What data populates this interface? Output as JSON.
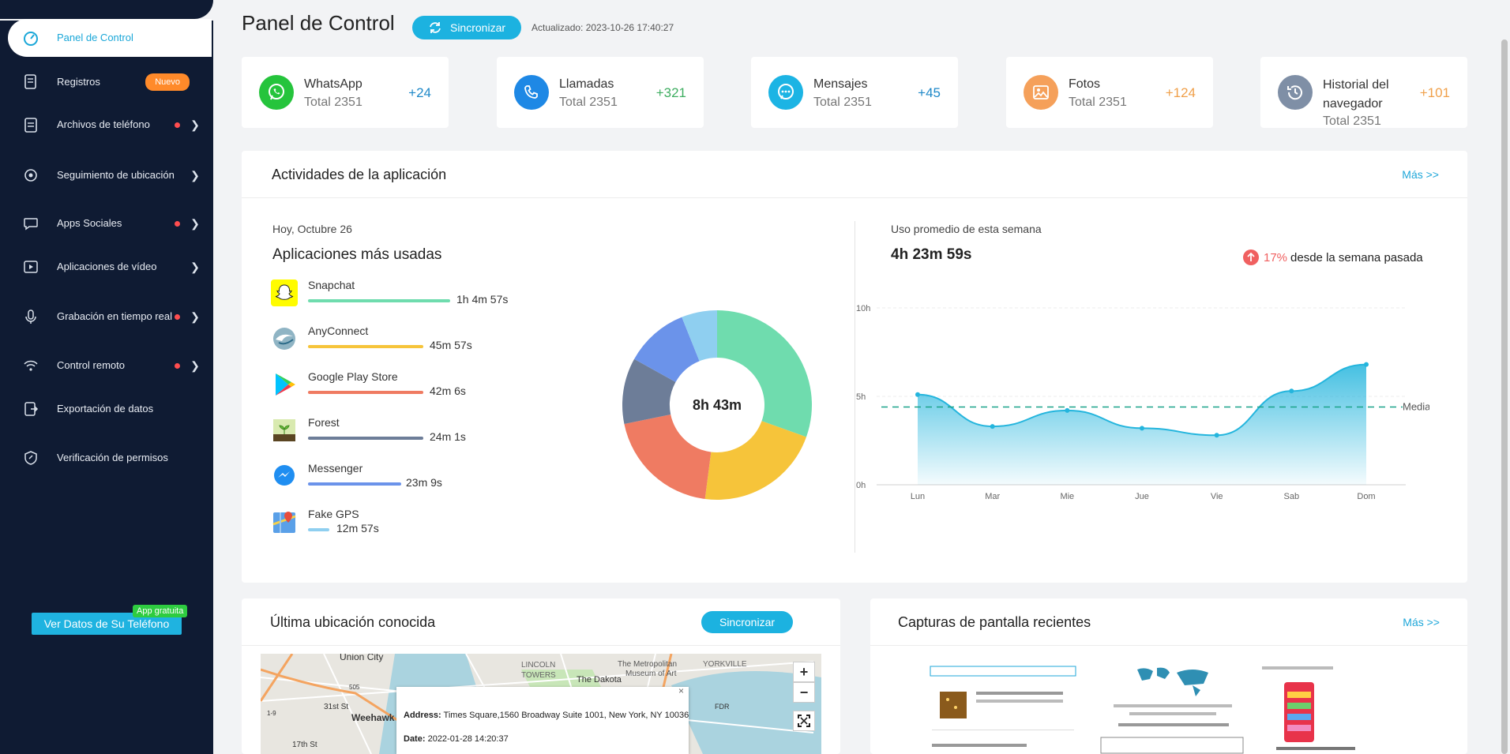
{
  "sidebar": {
    "items": [
      {
        "label": "Panel de Control"
      },
      {
        "label": "Registros",
        "badge": "Nuevo"
      },
      {
        "label": "Archivos de teléfono"
      },
      {
        "label": "Seguimiento de ubicación"
      },
      {
        "label": "Apps Sociales"
      },
      {
        "label": "Aplicaciones de vídeo"
      },
      {
        "label": "Grabación en tiempo real"
      },
      {
        "label": "Control remoto"
      },
      {
        "label": "Exportación de datos"
      },
      {
        "label": "Verificación de permisos"
      }
    ],
    "cta": "Ver Datos de Su Teléfono",
    "cta_badge": "App gratuita"
  },
  "header": {
    "title": "Panel de Control",
    "sync": "Sincronizar",
    "updated": "Actualizado: 2023-10-26 17:40:27"
  },
  "stats": [
    {
      "name": "WhatsApp",
      "total": "Total 2351",
      "delta": "+24",
      "color": "#25c43c",
      "icon": "whatsapp-icon"
    },
    {
      "name": "Llamadas",
      "total": "Total 2351",
      "delta": "+321",
      "color": "#1e88e5",
      "icon": "phone-icon"
    },
    {
      "name": "Mensajes",
      "total": "Total 2351",
      "delta": "+45",
      "color": "#1cb4e4",
      "icon": "message-icon"
    },
    {
      "name": "Fotos",
      "total": "Total 2351",
      "delta": "+124",
      "color": "#f5a05a",
      "icon": "photo-icon"
    },
    {
      "name": "Historial del navegador",
      "total": "Total 2351",
      "delta": "+101",
      "color": "#7f8fa6",
      "icon": "history-icon"
    }
  ],
  "activities": {
    "title": "Actividades de la aplicación",
    "more": "Más >>",
    "date": "Hoy, Octubre 26",
    "subtitle": "Aplicaciones más usadas",
    "apps": [
      {
        "name": "Snapchat",
        "time": "1h 4m 57s",
        "color": "#6fdcae",
        "share": 1.0
      },
      {
        "name": "AnyConnect",
        "time": "45m 57s",
        "color": "#f6c43a",
        "share": 0.82
      },
      {
        "name": "Google Play Store",
        "time": "42m 6s",
        "color": "#ef7b62",
        "share": 0.82
      },
      {
        "name": "Forest",
        "time": "24m 1s",
        "color": "#6d7d98",
        "share": 0.82
      },
      {
        "name": "Messenger",
        "time": "23m 9s",
        "color": "#6b93ea",
        "share": 0.66
      },
      {
        "name": "Fake GPS",
        "time": "12m 57s",
        "color": "#8fcff0",
        "share": 0.15
      }
    ],
    "donut_center": "8h 43m",
    "week_label": "Uso promedio de esta semana",
    "week_value": "4h 23m 59s",
    "week_pct": "17%",
    "week_pct_text": "desde la semana pasada"
  },
  "chart_data": {
    "type": "area",
    "x": [
      "Lun",
      "Mar",
      "Mie",
      "Jue",
      "Vie",
      "Sab",
      "Dom"
    ],
    "series": [
      {
        "values": [
          5.1,
          3.3,
          4.2,
          3.2,
          2.8,
          5.3,
          6.8
        ]
      }
    ],
    "ylim": [
      0,
      10
    ],
    "yticks": [
      "0h",
      "5h",
      "10h"
    ],
    "average": 4.4,
    "average_label": "Media",
    "color": "#24b5dd"
  },
  "location": {
    "title": "Última ubicación conocida",
    "sync": "Sincronizar",
    "address_label": "Address:",
    "address": "Times Square,1560 Broadway Suite 1001, New York, NY 10036",
    "date_label": "Date:",
    "date": "2022-01-28 14:20:37",
    "map_labels": [
      "Union City",
      "Weehawk",
      "LINCOLN",
      "TOWERS",
      "The Dakota",
      "The Metropolitan",
      "Museum of Art",
      "YORKVILLE",
      "FDR",
      "505",
      "1-9",
      "31st St",
      "17th St"
    ]
  },
  "screens": {
    "title": "Capturas de pantalla recientes",
    "more": "Más >>"
  }
}
